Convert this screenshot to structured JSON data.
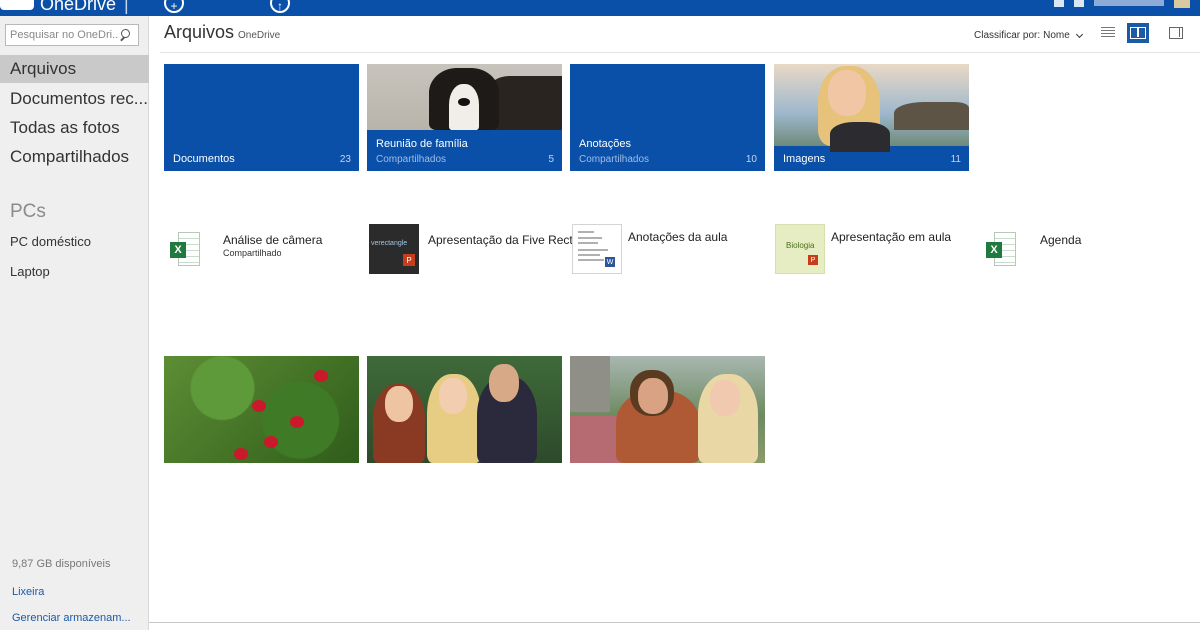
{
  "app": {
    "brand": "OneDrive"
  },
  "search": {
    "placeholder": "Pesquisar no OneDri..."
  },
  "sidebar": {
    "items": [
      {
        "label": "Arquivos"
      },
      {
        "label": "Documentos rec..."
      },
      {
        "label": "Todas as fotos"
      },
      {
        "label": "Compartilhados"
      }
    ],
    "pcs_heading": "PCs",
    "pcs": [
      {
        "label": "PC doméstico"
      },
      {
        "label": "Laptop"
      }
    ],
    "storage": "9,87 GB disponíveis",
    "recycle_bin": "Lixeira",
    "manage_storage": "Gerenciar armazenam..."
  },
  "header": {
    "title": "Arquivos",
    "subtitle": "OneDrive",
    "sort_label": "Classificar por:",
    "sort_value": "Nome"
  },
  "folders": [
    {
      "name": "Documentos",
      "subtitle": "",
      "count": "23"
    },
    {
      "name": "Reunião de família",
      "subtitle": "Compartilhados",
      "count": "5"
    },
    {
      "name": "Anotações",
      "subtitle": "Compartilhados",
      "count": "10"
    },
    {
      "name": "Imagens",
      "subtitle": "",
      "count": "11"
    }
  ],
  "files": [
    {
      "name": "Análise de câmera",
      "subtitle": "Compartilhado",
      "icon": "excel-icon"
    },
    {
      "name": "Apresentação da Five Recta",
      "subtitle": "",
      "icon": "powerpoint-thumbnail",
      "thumb_text": "verectangle"
    },
    {
      "name": "Anotações da aula",
      "subtitle": "",
      "icon": "word-thumbnail"
    },
    {
      "name": "Apresentação em aula",
      "subtitle": "",
      "icon": "powerpoint-thumbnail",
      "thumb_text": "Biologia"
    },
    {
      "name": "Agenda",
      "subtitle": "",
      "icon": "excel-icon"
    }
  ],
  "photos": [
    {
      "name": "flowers-photo"
    },
    {
      "name": "friends-photo"
    },
    {
      "name": "park-photo"
    }
  ],
  "colors": {
    "accent": "#0a4fa8",
    "sidebar_bg": "#efefef",
    "link": "#1b5aa6"
  }
}
